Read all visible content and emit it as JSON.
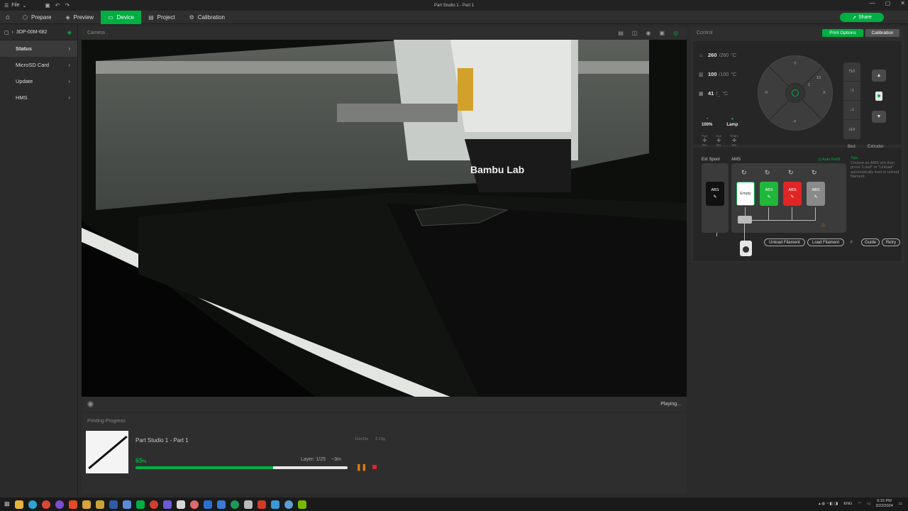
{
  "titlebar": {
    "file_label": "File",
    "title": "Part Studio 1 - Part 1"
  },
  "nav": {
    "tabs": [
      {
        "label": "Prepare",
        "icon": "cube-icon"
      },
      {
        "label": "Preview",
        "icon": "layers-icon"
      },
      {
        "label": "Device",
        "icon": "monitor-icon"
      },
      {
        "label": "Project",
        "icon": "project-icon"
      },
      {
        "label": "Calibration",
        "icon": "calibration-icon"
      }
    ],
    "active_tab": "Device",
    "share_label": "Share"
  },
  "sidebar": {
    "device_name": "3DP-00M-682",
    "items": [
      {
        "label": "Status"
      },
      {
        "label": "MicroSD Card"
      },
      {
        "label": "Update"
      },
      {
        "label": "HMS"
      }
    ]
  },
  "camera": {
    "header": "Camera",
    "printer_brand": "Bambu Lab",
    "status": "Playing..."
  },
  "progress": {
    "header": "Printing Progress",
    "job_name": "Part Studio 1 - Part 1",
    "time_estimate": "11m29s",
    "weight": "2.19g",
    "percent_value": "65",
    "percent_unit": "%",
    "progress_fraction": 0.65,
    "layer": "Layer: 1/25",
    "remaining": "~3m"
  },
  "control": {
    "header": "Control",
    "print_options_label": "Print Options",
    "calibration_label": "Calibration",
    "nozzle": {
      "current": "260",
      "target": "/260",
      "unit": "°C"
    },
    "bed": {
      "current": "100",
      "target": "/100",
      "unit": "°C"
    },
    "chamber": {
      "current": "41",
      "target": "/_",
      "unit": "°C"
    },
    "speed": {
      "value": "100%"
    },
    "lamp": {
      "label": "Lamp"
    },
    "fans": [
      {
        "label": "Part",
        "value": "0%"
      },
      {
        "label": "Aux",
        "value": "0%"
      },
      {
        "label": "Cham",
        "value": "0%"
      }
    ],
    "jog": {
      "y": "Y",
      "neg_y": "-Y",
      "x": "X",
      "neg_x": "-X",
      "ten": "10",
      "one": "1"
    },
    "bed_steps": [
      "10",
      "1",
      "1",
      "10"
    ],
    "bed_label": "Bed",
    "extruder_label": "Extruder"
  },
  "ams": {
    "ext_spool_label": "Ext Spool",
    "ams_label": "AMS",
    "auto_refill": "Auto Refill",
    "tips_title": "Tips",
    "tips_text": "Choose an AMS slot then press \"Load\" or \"Unload\" automatically load or unload filament.",
    "ext_slot": {
      "material": "ABS",
      "color": "#111111"
    },
    "slots": [
      {
        "material": "Empty",
        "color": "#ffffff"
      },
      {
        "material": "ABS",
        "color": "#1fb83a"
      },
      {
        "material": "ABS",
        "color": "#e02525"
      },
      {
        "material": "ABS",
        "color": "#8a8a8a"
      }
    ],
    "unload_label": "Unload Filament",
    "load_label": "Load Filament",
    "guide_label": "Guide",
    "retry_label": "Retry"
  },
  "taskbar": {
    "language": "ENG",
    "time": "6:15 PM",
    "date": "3/22/2024"
  },
  "colors": {
    "accent": "#00ae42",
    "panel": "#2e2e2e",
    "background": "#2b2b2b"
  }
}
